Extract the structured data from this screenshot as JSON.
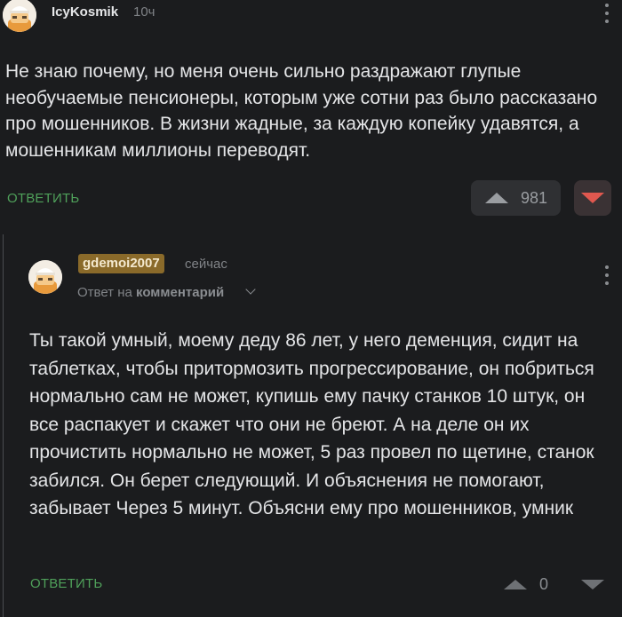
{
  "comment": {
    "username": "IcyKosmik",
    "time": "10ч",
    "text": "Не знаю почему, но меня очень сильно раздражают глупые необучаемые пенсионеры, которым уже сотни раз было рассказано про мошенников. В жизни жадные, за каждую копейку удавятся, а мошенникам миллионы переводят.",
    "reply_label": "ОТВЕТИТЬ",
    "rating": "981",
    "icons": {
      "more": "more-vertical-icon",
      "upvote": "upvote-icon",
      "downvote": "downvote-icon"
    }
  },
  "reply": {
    "username": "gdemoi2007",
    "time": "сейчас",
    "reply_to_prefix": "Ответ на",
    "reply_to_target": "комментарий",
    "text": "Ты такой умный, моему деду 86 лет, у него деменция, сидит на таблетках, чтобы притормозить прогрессирование, он побриться нормально сам не может, купишь ему пачку станков 10 штук, он все распакует и скажет что они не бреют. А на деле он их прочистить нормально не может, 5 раз провел по щетине, станок забился. Он берет следующий. И объяснения не помогают, забывает Через 5 минут. Объясни ему про мошенников, умник",
    "reply_label": "ОТВЕТИТЬ",
    "rating": "0",
    "username_badge_color": "#8a6a2a"
  },
  "colors": {
    "background": "#1b1c1e",
    "accent_green": "#4fa05a",
    "downvote_red": "#e0584f"
  }
}
